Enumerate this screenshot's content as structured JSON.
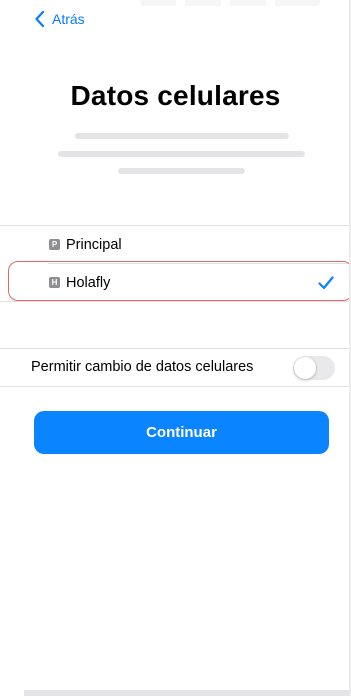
{
  "nav": {
    "back_label": "Atrás"
  },
  "header": {
    "title": "Datos celulares"
  },
  "lines": [
    {
      "label": "Principal",
      "badge": "P",
      "selected": false
    },
    {
      "label": "Holafly",
      "badge": "H",
      "selected": true
    }
  ],
  "settings": {
    "switching_label": "Permitir cambio de datos celulares",
    "switching_enabled": false
  },
  "actions": {
    "continue_label": "Continuar"
  },
  "colors": {
    "accent": "#0a84ff",
    "link": "#0a7aff",
    "highlight_border": "#e06969",
    "badge": "#8e8e93",
    "toggle_off": "#e9e9eb"
  },
  "icons": [
    "chevron-left-icon",
    "checkmark-icon",
    "sim-p-icon",
    "sim-h-icon"
  ]
}
